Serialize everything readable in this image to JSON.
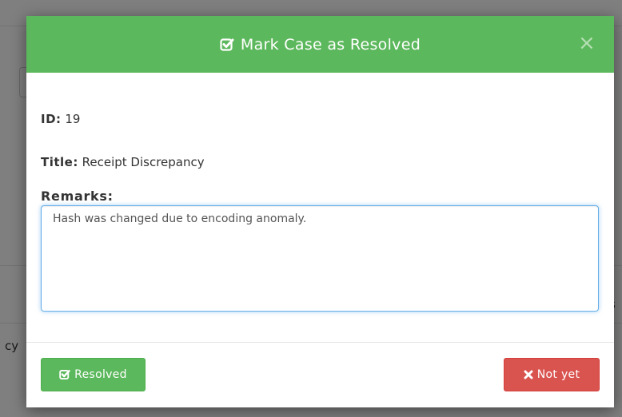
{
  "modal": {
    "title": "Mark Case as Resolved",
    "close_symbol": "×",
    "title_icon": "check-square-icon"
  },
  "case": {
    "id_label": "ID:",
    "id_value": "19",
    "title_label": "Title:",
    "title_value": "Receipt Discrepancy"
  },
  "remarks": {
    "label": "Remarks:",
    "value": "Hash was changed due to encoding anomaly."
  },
  "footer": {
    "resolved_label": "Resolved",
    "resolved_icon": "check-square-icon",
    "notyet_label": "Not yet",
    "notyet_icon": "x-icon"
  },
  "background": {
    "fragment_left": "cy",
    "fragment_right": "s"
  },
  "colors": {
    "success": "#5cb85c",
    "danger": "#d9534f",
    "focus": "#66afe9"
  }
}
